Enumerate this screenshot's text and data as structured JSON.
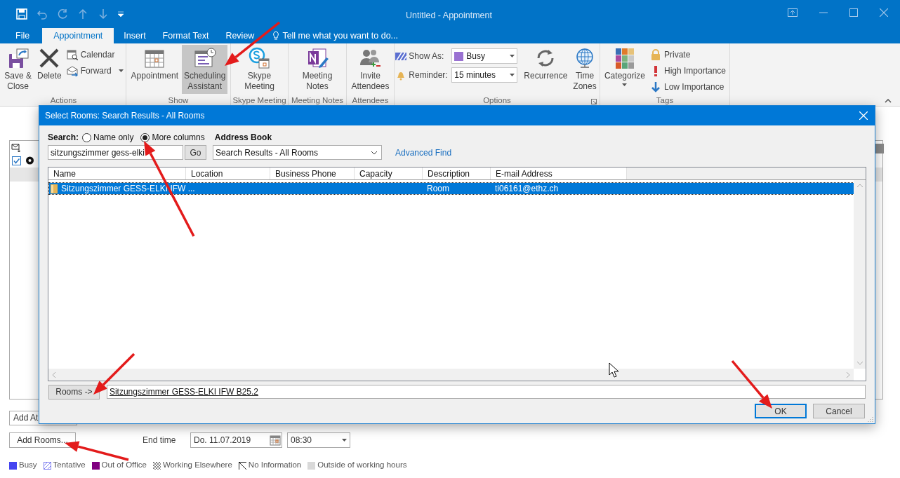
{
  "window": {
    "title": "Untitled - Appointment"
  },
  "ribbon_tabs": [
    {
      "label": "File",
      "selected": false
    },
    {
      "label": "Appointment",
      "selected": true
    },
    {
      "label": "Insert",
      "selected": false
    },
    {
      "label": "Format Text",
      "selected": false
    },
    {
      "label": "Review",
      "selected": false
    }
  ],
  "tell_me": "Tell me what you want to do...",
  "ribbon_groups": [
    {
      "label": "Actions",
      "items": [
        {
          "kind": "large",
          "label": "Save &\nClose"
        },
        {
          "kind": "large",
          "label": "Delete"
        },
        {
          "kind": "stack",
          "items": [
            {
              "kind": "small",
              "label": "Calendar"
            },
            {
              "kind": "small",
              "label": "Forward",
              "has_menu": true
            }
          ]
        }
      ]
    },
    {
      "label": "Show",
      "items": [
        {
          "kind": "large",
          "label": "Appointment",
          "selected": false
        },
        {
          "kind": "large",
          "label": "Scheduling\nAssistant",
          "selected": true
        }
      ]
    },
    {
      "label": "Skype Meeting",
      "items": [
        {
          "kind": "large",
          "label": "Skype\nMeeting"
        }
      ]
    },
    {
      "label": "Meeting Notes",
      "items": [
        {
          "kind": "large",
          "label": "Meeting\nNotes"
        }
      ]
    },
    {
      "label": "Attendees",
      "items": [
        {
          "kind": "large",
          "label": "Invite\nAttendees"
        }
      ]
    },
    {
      "label": "Options",
      "launcher": true,
      "items": [
        {
          "kind": "stack",
          "items": [
            {
              "kind": "dropdown",
              "label": "Show As:",
              "value": "Busy"
            },
            {
              "kind": "dropdown",
              "label": "Reminder:",
              "value": "15 minutes"
            }
          ]
        },
        {
          "kind": "large",
          "label": "Recurrence"
        },
        {
          "kind": "large",
          "label": "Time\nZones"
        }
      ]
    },
    {
      "label": "Tags",
      "items": [
        {
          "kind": "large",
          "label": "Categorize",
          "has_menu": true
        },
        {
          "kind": "stack",
          "items": [
            {
              "kind": "small",
              "label": "Private"
            },
            {
              "kind": "small",
              "label": "High Importance"
            },
            {
              "kind": "small",
              "label": "Low Importance"
            }
          ]
        }
      ]
    }
  ],
  "form": {
    "add_attendees_button": "Add At",
    "add_rooms_button": "Add Rooms...",
    "end_time_label": "End time",
    "end_date": "Do. 11.07.2019",
    "end_time": "08:30"
  },
  "legend": [
    {
      "label": "Busy",
      "kind": "solid",
      "color": "#4444f0"
    },
    {
      "label": "Tentative",
      "kind": "hatched",
      "color": "#8080f0"
    },
    {
      "label": "Out of Office",
      "kind": "solid",
      "color": "#800080"
    },
    {
      "label": "Working Elsewhere",
      "kind": "dotted",
      "color": "#808080"
    },
    {
      "label": "No Information",
      "kind": "diagonal",
      "color": "#202020"
    },
    {
      "label": "Outside of working hours",
      "kind": "solid",
      "color": "#d9d9d9"
    }
  ],
  "dialog": {
    "title": "Select Rooms: Search Results - All Rooms",
    "search_label": "Search:",
    "search_modes": [
      {
        "label": "Name only",
        "selected": false
      },
      {
        "label": "More columns",
        "selected": true
      }
    ],
    "address_book_label": "Address Book",
    "search_value": "sitzungszimmer gess-elki",
    "go_button": "Go",
    "address_book": "Search Results - All Rooms",
    "advanced_find": "Advanced Find",
    "columns": [
      "Name",
      "Location",
      "Business Phone",
      "Capacity",
      "Description",
      "E-mail Address"
    ],
    "rows": [
      {
        "name": "Sitzungszimmer GESS-ELKI IFW ...",
        "description": "Room",
        "email": "ti06161@ethz.ch",
        "selected": true
      }
    ],
    "rooms_button": "Rooms ->",
    "rooms_value": "Sitzungszimmer GESS-ELKI IFW B25.2",
    "buttons": [
      {
        "label": "OK",
        "default": true
      },
      {
        "label": "Cancel",
        "default": false
      }
    ]
  }
}
